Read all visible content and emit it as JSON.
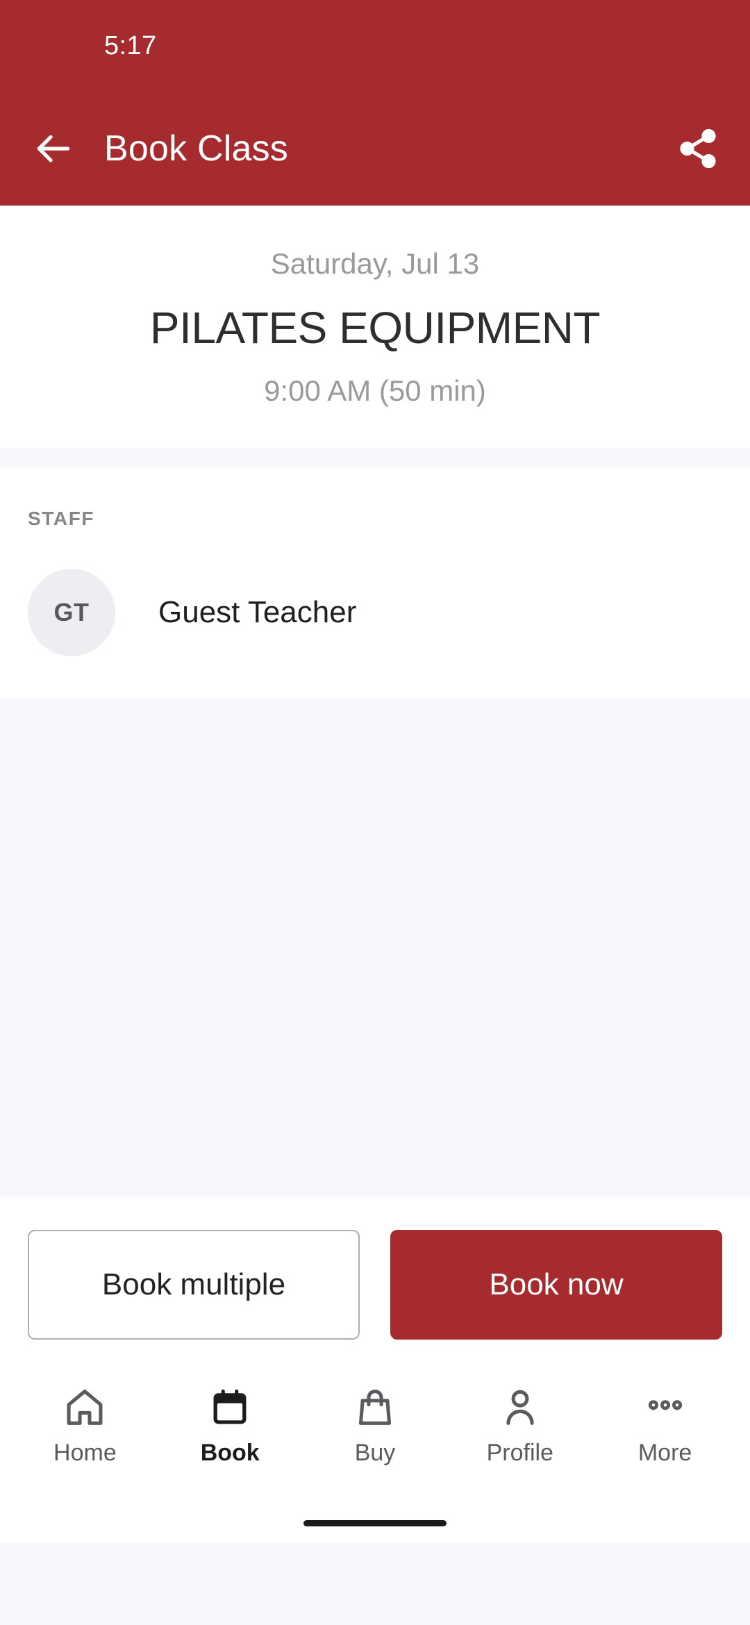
{
  "status_bar": {
    "time": "5:17"
  },
  "app_bar": {
    "title": "Book Class",
    "back_icon": "arrow-left-icon",
    "share_icon": "share-icon",
    "background_color": "#A62B2E"
  },
  "class_summary": {
    "date": "Saturday, Jul 13",
    "name": "PILATES EQUIPMENT",
    "time": "9:00 AM (50 min)"
  },
  "staff_section": {
    "label": "STAFF",
    "members": [
      {
        "initials": "GT",
        "name": "Guest Teacher"
      }
    ]
  },
  "actions": {
    "secondary_label": "Book multiple",
    "primary_label": "Book now",
    "primary_color": "#A62B2E"
  },
  "bottom_nav": {
    "items": [
      {
        "label": "Home",
        "icon": "home-icon",
        "active": false
      },
      {
        "label": "Book",
        "icon": "calendar-icon",
        "active": true
      },
      {
        "label": "Buy",
        "icon": "shopping-bag-icon",
        "active": false
      },
      {
        "label": "Profile",
        "icon": "person-icon",
        "active": false
      },
      {
        "label": "More",
        "icon": "ellipsis-icon",
        "active": false
      }
    ]
  }
}
